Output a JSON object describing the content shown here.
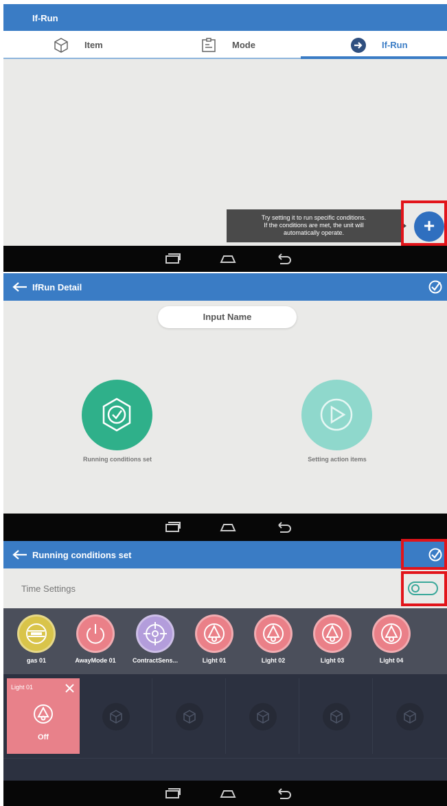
{
  "panel1": {
    "title": "If-Run",
    "tabs": [
      {
        "label": "Item",
        "icon": "cube-icon"
      },
      {
        "label": "Mode",
        "icon": "mode-icon"
      },
      {
        "label": "If-Run",
        "icon": "arrow-circle-icon"
      }
    ],
    "tooltip": {
      "line1": "Try setting it to run specific conditions.",
      "line2": "If the conditions are met, the unit will",
      "line3": "automatically operate."
    },
    "fab_label": "+"
  },
  "panel2": {
    "title": "IfRun Detail",
    "input_placeholder": "Input Name",
    "if_caption": "Running conditions set",
    "action_caption": "Setting action items"
  },
  "panel3": {
    "title": "Running conditions set",
    "time_settings": "Time Settings",
    "devices": [
      {
        "label": "gas 01",
        "color": "#d9c44a"
      },
      {
        "label": "AwayMode 01",
        "color": "#ea8088"
      },
      {
        "label": "ContractSens...",
        "color": "#b39ddb"
      },
      {
        "label": "Light 01",
        "color": "#ea8088"
      },
      {
        "label": "Light 02",
        "color": "#ea8088"
      },
      {
        "label": "Light 03",
        "color": "#ea8088"
      },
      {
        "label": "Light 04",
        "color": "#ea8088"
      }
    ],
    "card": {
      "title": "Light 01",
      "state": "Off"
    }
  },
  "colors": {
    "primary": "#3a7cc5",
    "highlight": "#e2141a",
    "if_green": "#2fb08a",
    "action_teal": "#8fd8cc"
  }
}
